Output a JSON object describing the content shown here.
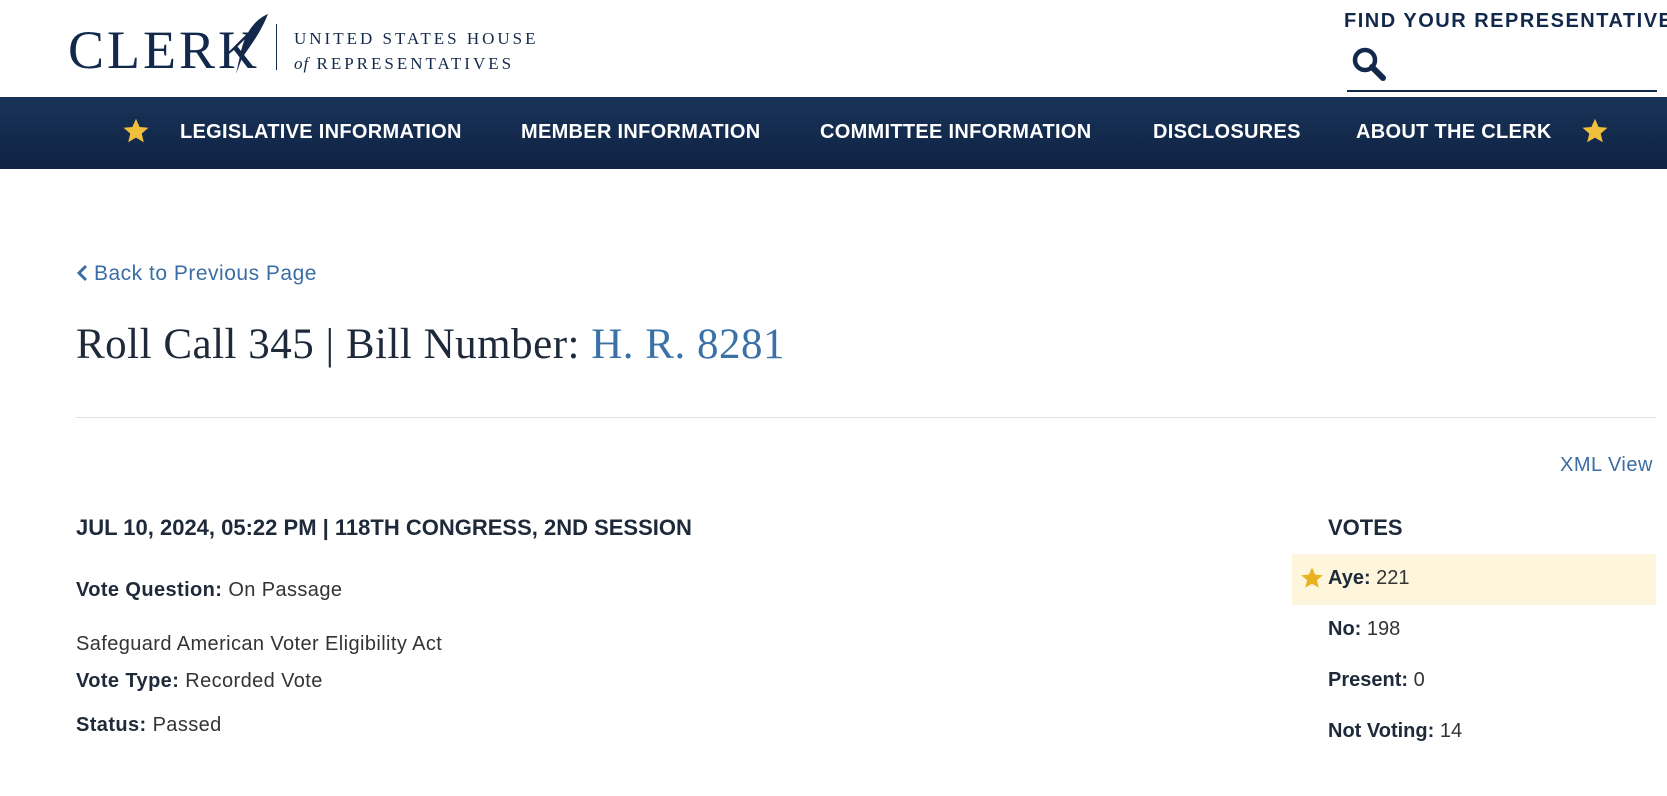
{
  "header": {
    "logo_word": "CLERK",
    "logo_line1": "UNITED STATES HOUSE",
    "logo_of": "of",
    "logo_line2": "REPRESENTATIVES",
    "find_rep_label": "FIND YOUR REPRESENTATIVE",
    "search_value": ""
  },
  "nav": {
    "items": [
      {
        "label": "LEGISLATIVE INFORMATION"
      },
      {
        "label": "MEMBER INFORMATION"
      },
      {
        "label": "COMMITTEE INFORMATION"
      },
      {
        "label": "DISCLOSURES"
      },
      {
        "label": "ABOUT THE CLERK"
      }
    ]
  },
  "main": {
    "back_label": "Back to Previous Page",
    "title_prefix": "Roll Call 345 | Bill Number: ",
    "bill_number": "H. R. 8281",
    "xml_view": "XML View",
    "date_line": "JUL 10, 2024, 05:22 PM | 118TH CONGRESS, 2ND SESSION",
    "vote_question_label": "Vote Question:",
    "vote_question_value": "On Passage",
    "bill_title": "Safeguard American Voter Eligibility Act",
    "vote_type_label": "Vote Type:",
    "vote_type_value": "Recorded Vote",
    "status_label": "Status:",
    "status_value": "Passed"
  },
  "votes": {
    "heading": "VOTES",
    "rows": [
      {
        "label": "Aye:",
        "value": "221"
      },
      {
        "label": "No:",
        "value": "198"
      },
      {
        "label": "Present:",
        "value": "0"
      },
      {
        "label": "Not Voting:",
        "value": "14"
      }
    ]
  },
  "colors": {
    "navy": "#13294b",
    "link": "#3a6ea5",
    "star_gold": "#f0c03c",
    "highlight": "#fdf5dc"
  }
}
